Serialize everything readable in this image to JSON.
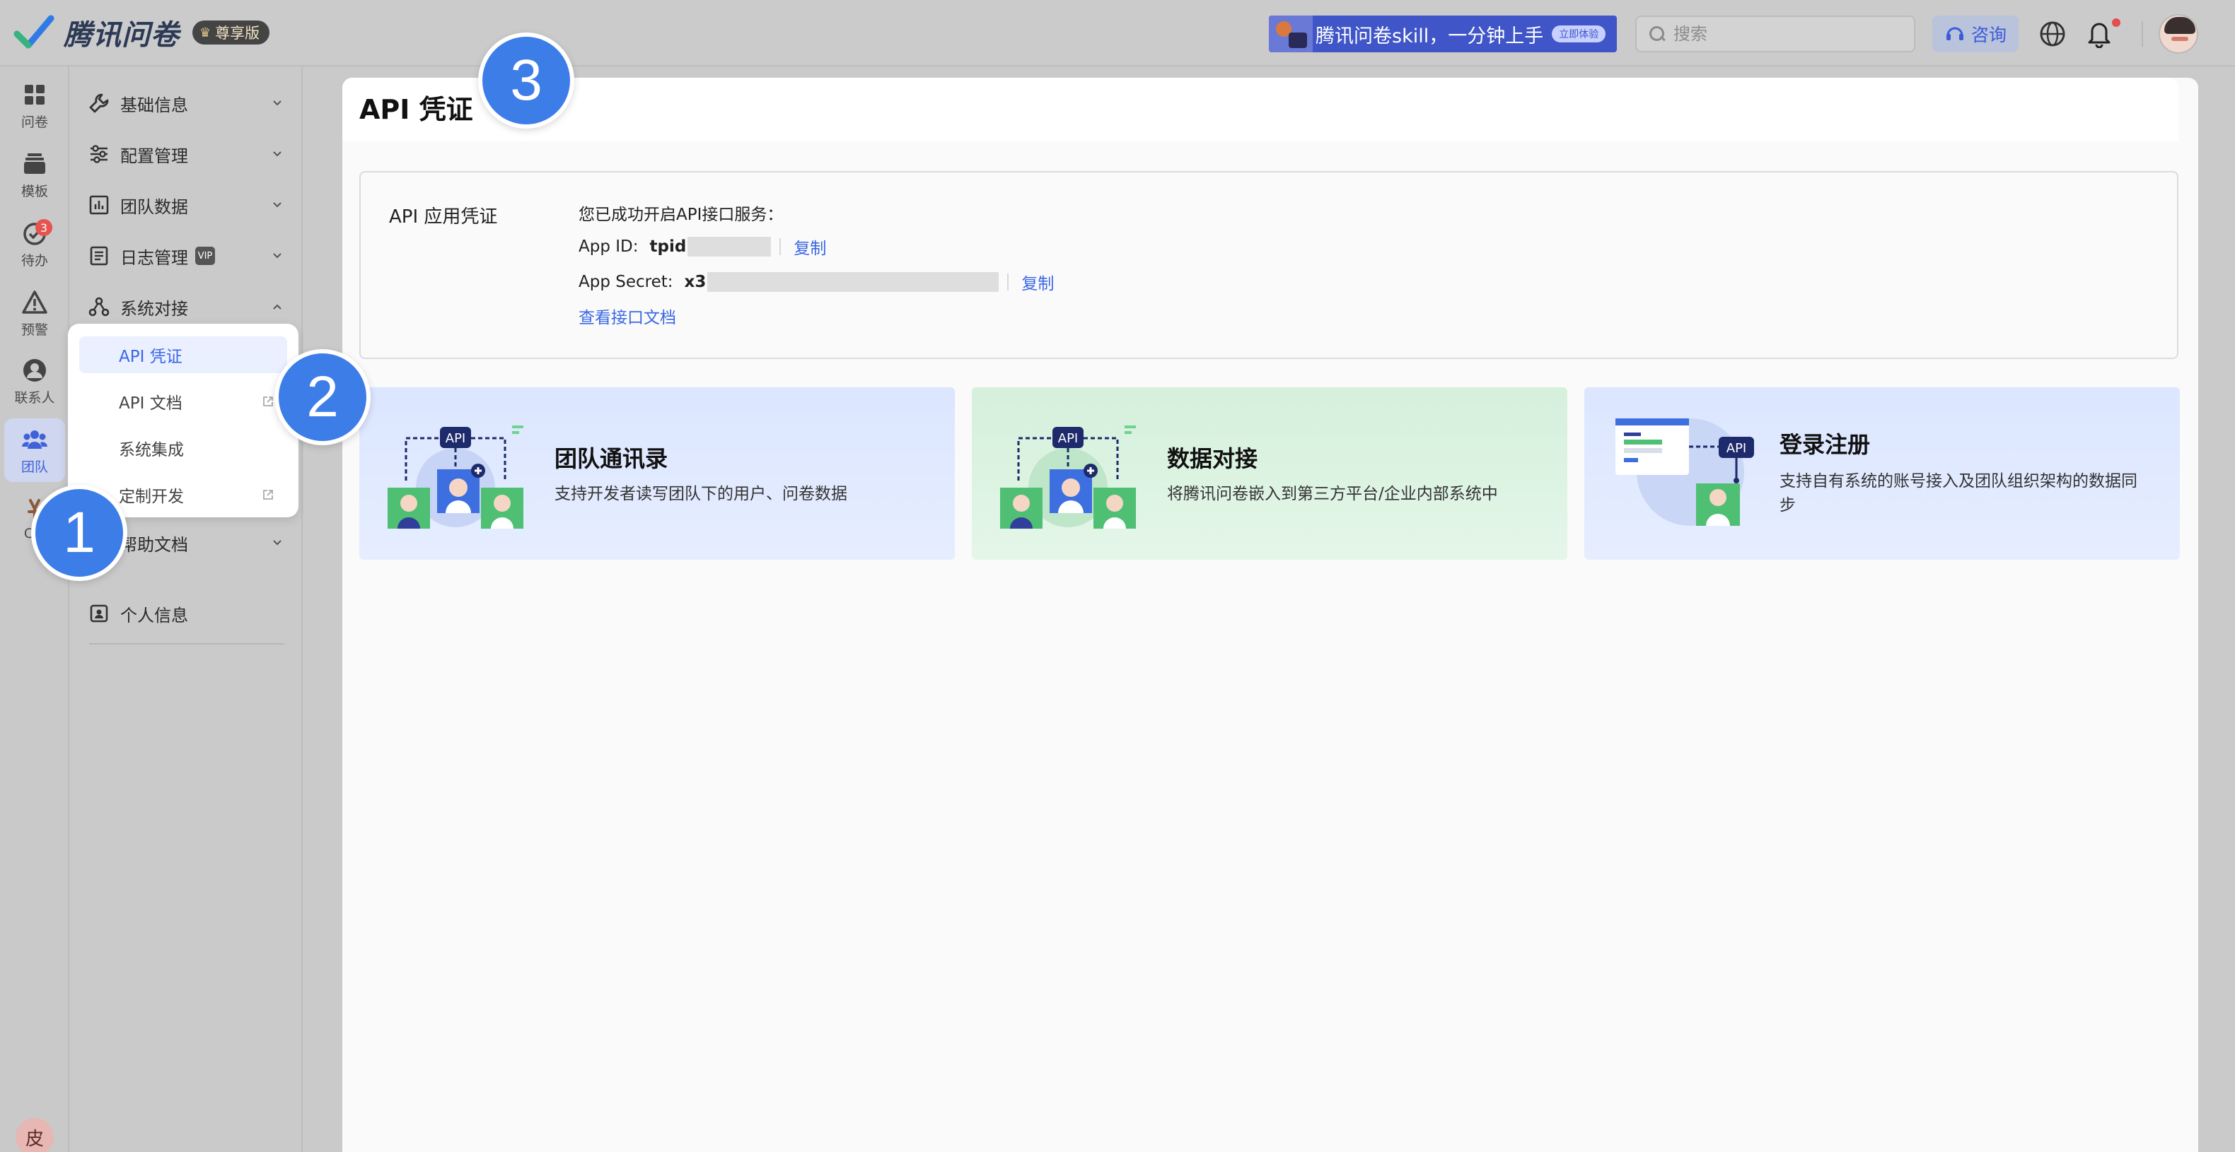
{
  "header": {
    "app_name": "腾讯问卷",
    "edition": "尊享版",
    "promo": {
      "text": "腾讯问卷skill，一分钟上手",
      "button": "立即体验"
    },
    "search_placeholder": "搜索",
    "consult_label": "咨询"
  },
  "rail": {
    "items": [
      {
        "label": "问卷",
        "icon": "grid-icon"
      },
      {
        "label": "模板",
        "icon": "template-icon"
      },
      {
        "label": "待办",
        "icon": "todo-icon",
        "badge": "3"
      },
      {
        "label": "预警",
        "icon": "warning-icon"
      },
      {
        "label": "联系人",
        "icon": "contact-icon"
      },
      {
        "label": "团队",
        "icon": "team-icon",
        "active": true
      },
      {
        "label": "Cla",
        "icon": "class-icon"
      }
    ],
    "user_initial": "皮"
  },
  "sidebar": {
    "items": [
      {
        "label": "基础信息",
        "icon": "wrench-icon"
      },
      {
        "label": "配置管理",
        "icon": "sliders-icon"
      },
      {
        "label": "团队数据",
        "icon": "chart-icon"
      },
      {
        "label": "日志管理",
        "icon": "log-icon",
        "tag": "VIP"
      },
      {
        "label": "系统对接",
        "icon": "connect-icon",
        "expanded": true
      },
      {
        "label": "帮助文档",
        "icon": "help-icon"
      },
      {
        "label": "个人信息",
        "icon": "profile-icon"
      }
    ],
    "submenu": [
      {
        "label": "API 凭证",
        "active": true
      },
      {
        "label": "API 文档",
        "external": true
      },
      {
        "label": "系统集成"
      },
      {
        "label": "定制开发",
        "external": true
      }
    ]
  },
  "main": {
    "title": "API 凭证",
    "credentials": {
      "section_label": "API 应用凭证",
      "success_text": "您已成功开启API接口服务：",
      "app_id_label": "App ID:",
      "app_id_value": "tpid",
      "app_secret_label": "App Secret:",
      "app_secret_value": "x3",
      "copy_label": "复制",
      "doc_link": "查看接口文档"
    },
    "cards": [
      {
        "title": "团队通讯录",
        "desc": "支持开发者读写团队下的用户、问卷数据",
        "art_label": "API"
      },
      {
        "title": "数据对接",
        "desc": "将腾讯问卷嵌入到第三方平台/企业内部系统中",
        "art_label": "API"
      },
      {
        "title": "登录注册",
        "desc": "支持自有系统的账号接入及团队组织架构的数据同步",
        "art_label": "API"
      }
    ]
  },
  "steps": [
    "1",
    "2",
    "3"
  ]
}
